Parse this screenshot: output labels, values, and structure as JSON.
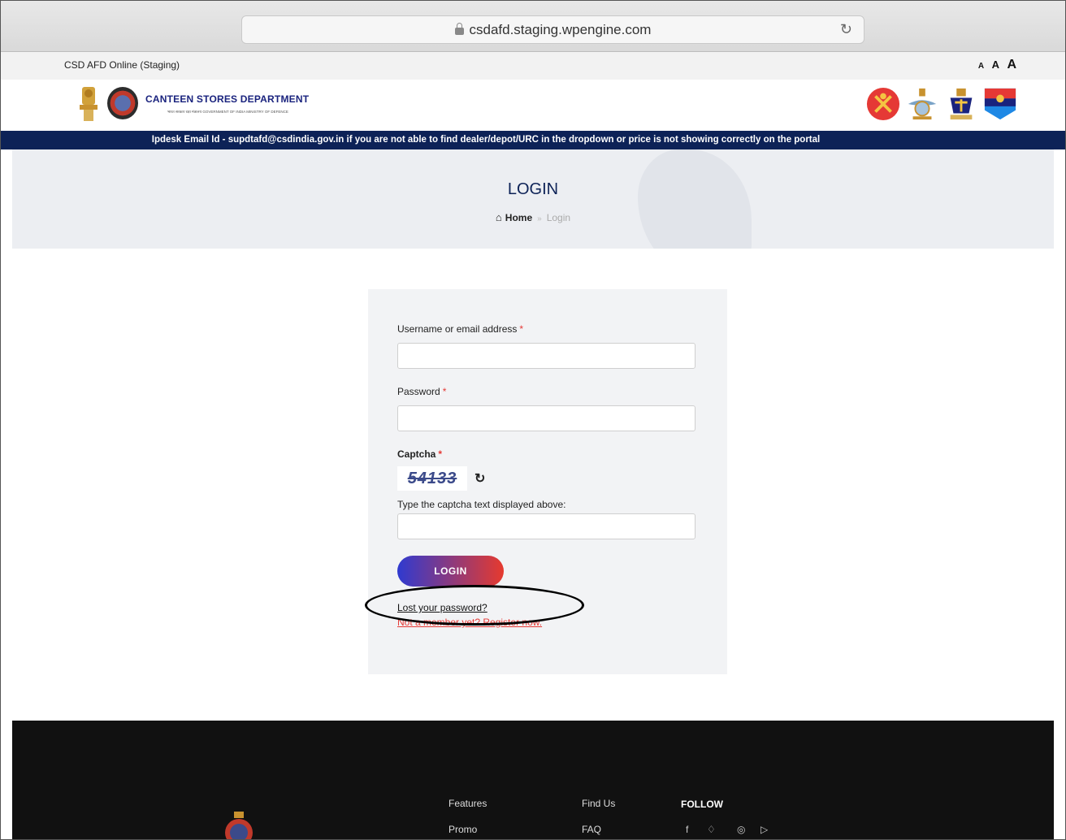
{
  "browser": {
    "url": "csdafd.staging.wpengine.com"
  },
  "topbar": {
    "site_name": "CSD AFD Online (Staging)",
    "font_small": "A",
    "font_medium": "A",
    "font_large": "A"
  },
  "header": {
    "dept_title": "CANTEEN STORES DEPARTMENT",
    "dept_subtitle": "भारत सरकार  रक्षा मंत्रालय  GOVERNMENT OF INDIA  MINISTRY OF DEFENCE"
  },
  "banner": {
    "text": "Ipdesk Email Id - supdtafd@csdindia.gov.in if you are not able to find dealer/depot/URC in the dropdown or price is not showing correctly on the portal"
  },
  "hero": {
    "title": "LOGIN",
    "breadcrumb_home": "Home",
    "breadcrumb_current": "Login",
    "breadcrumb_sep": "»"
  },
  "form": {
    "username_label": "Username or email address",
    "password_label": "Password",
    "captcha_label": "Captcha",
    "captcha_text": "54133",
    "captcha_hint": "Type the captcha text displayed above:",
    "required_mark": "*",
    "username_value": "",
    "password_value": "",
    "captcha_value": "",
    "login_button": "LOGIN",
    "lost_password": "Lost your password?",
    "register": "Not a member yet? Register now."
  },
  "footer": {
    "col1": [
      "Features",
      "Promo"
    ],
    "col2": [
      "Find Us",
      "FAQ"
    ],
    "follow": "FOLLOW",
    "social_icons": [
      "facebook-icon",
      "twitter-icon",
      "instagram-icon",
      "youtube-icon"
    ]
  },
  "colors": {
    "navy": "#0d2257",
    "required": "#e53935",
    "btn_start": "#2f3ad0",
    "btn_end": "#e63a2e"
  }
}
